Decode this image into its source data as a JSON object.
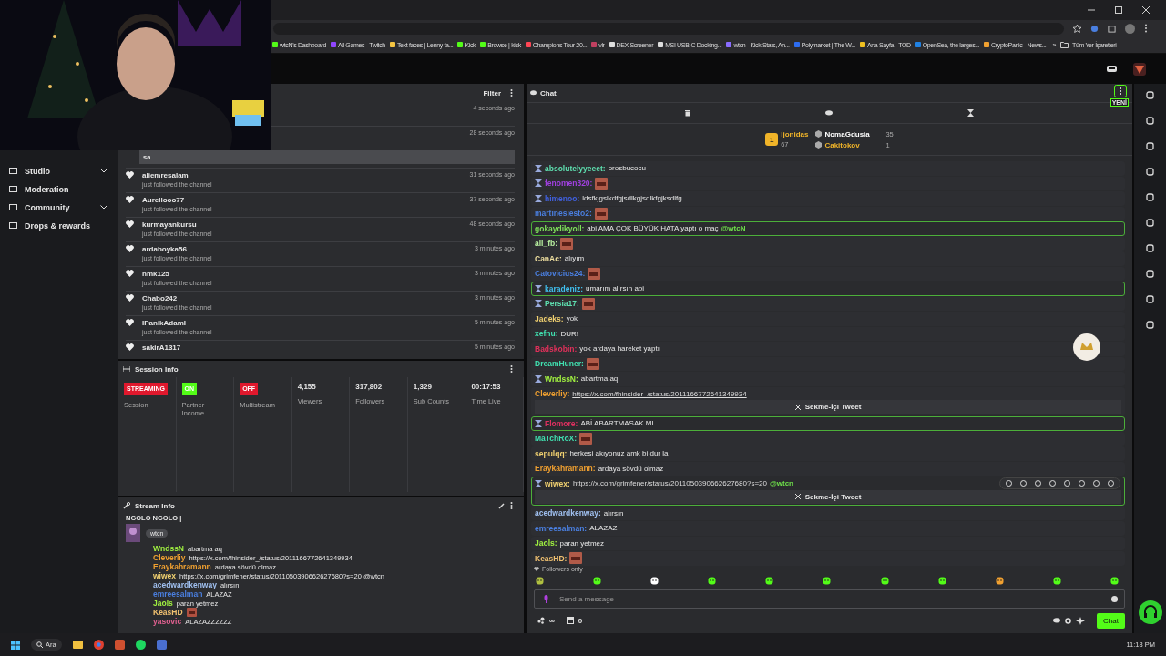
{
  "bookmarks": [
    {
      "label": "wtcN's Dashboard",
      "color": "#53fc18"
    },
    {
      "label": "All Games - Twitch",
      "color": "#9146ff"
    },
    {
      "label": "Text faces | Lenny fa...",
      "color": "#f5c542"
    },
    {
      "label": "Kick",
      "color": "#53fc18"
    },
    {
      "label": "Browse | kick",
      "color": "#53fc18"
    },
    {
      "label": "Champions Tour 20...",
      "color": "#ff4655"
    },
    {
      "label": "vlr",
      "color": "#c04060"
    },
    {
      "label": "DEX Screener",
      "color": "#dddddd"
    },
    {
      "label": "MSI USB-C Docking...",
      "color": "#dddddd"
    },
    {
      "label": "wtcn - Kick Stats, An...",
      "color": "#8a6cff"
    },
    {
      "label": "Polymarket | The W...",
      "color": "#2d6cf0"
    },
    {
      "label": "Ana Sayfa - TOD",
      "color": "#f0c020"
    },
    {
      "label": "OpenSea, the larges...",
      "color": "#2081e2"
    },
    {
      "label": "CryptoPanic - News...",
      "color": "#f0a030"
    }
  ],
  "bookmarks_more": "»",
  "all_bookmarks": "Tüm Yer İşaretleri",
  "sidebar": {
    "items": [
      {
        "label": "Studio",
        "expandable": true
      },
      {
        "label": "Moderation",
        "expandable": false
      },
      {
        "label": "Community",
        "expandable": true
      },
      {
        "label": "Drops & rewards",
        "expandable": false
      }
    ]
  },
  "activity": {
    "filter": "Filter",
    "events": [
      {
        "time": "4 seconds ago"
      },
      {
        "time": "28 seconds ago",
        "message": "sa"
      },
      {
        "user": "aliemresalam",
        "note": "just followed the channel",
        "time": "31 seconds ago"
      },
      {
        "user": "Aurellooo77",
        "note": "just followed the channel",
        "time": "37 seconds ago"
      },
      {
        "user": "kurmayankursu",
        "note": "just followed the channel",
        "time": "48 seconds ago"
      },
      {
        "user": "ardaboyka56",
        "note": "just followed the channel",
        "time": "3 minutes ago"
      },
      {
        "user": "hmk125",
        "note": "just followed the channel",
        "time": "3 minutes ago"
      },
      {
        "user": "Chabo242",
        "note": "just followed the channel",
        "time": "3 minutes ago"
      },
      {
        "user": "IPanikAdamI",
        "note": "just followed the channel",
        "time": "5 minutes ago"
      },
      {
        "user": "sakirA1317",
        "time": "5 minutes ago"
      }
    ]
  },
  "session_info": {
    "title": "Session Info",
    "tiles": [
      {
        "kind": "status",
        "badge": "STREAMING",
        "color": "#e0182d",
        "label": "Session"
      },
      {
        "kind": "status",
        "badge": "ON",
        "color": "#53fc18",
        "label": "Partner Income"
      },
      {
        "kind": "status",
        "badge": "OFF",
        "color": "#e0182d",
        "label": "Multistream"
      },
      {
        "kind": "stat",
        "value": "4,155",
        "label": "Viewers"
      },
      {
        "kind": "stat",
        "value": "317,802",
        "label": "Followers"
      },
      {
        "kind": "stat",
        "value": "1,329",
        "label": "Sub Counts"
      },
      {
        "kind": "stat",
        "value": "00:17:53",
        "label": "Time Live"
      }
    ]
  },
  "stream_info": {
    "title": "Stream Info",
    "stream_title": "NGOLO NGOLO |",
    "lines": [
      {
        "user": "WndssN",
        "color": "#a0f040",
        "text": "abartma aq"
      },
      {
        "user": "Cleverliy",
        "color": "#f0a030",
        "text": "https://x.com/fhinsider_/status/2011166772641349934"
      },
      {
        "user": "Eraykahramann",
        "color": "#f0a030",
        "text": "ardaya sövdü olmaz"
      },
      {
        "user": "wiwex",
        "color": "#f0d070",
        "text": "https://x.com/grimfener/status/2011050390662627680?s=20 @wtcn"
      },
      {
        "user": "acedwardkenway",
        "color": "#a0c0f0",
        "text": "alırsın"
      },
      {
        "user": "emreesalman",
        "color": "#4a7fe0",
        "text": "ALAZAZ"
      },
      {
        "user": "Jaols",
        "color": "#a0f040",
        "text": "paran yetmez"
      },
      {
        "user": "KeasHD",
        "color": "#f0c070",
        "emote": true
      },
      {
        "user": "yasovic",
        "color": "#e06090",
        "text": "ALAZAZZZZZZ"
      }
    ],
    "tags": [
      "wtcn"
    ]
  },
  "chat": {
    "title": "Chat",
    "new_badge": "YENİ",
    "gifters": [
      {
        "rank": "1",
        "name": "ljonidas",
        "count": "67",
        "color": "#f0b429"
      },
      {
        "name": "NomaGdusia",
        "count": "35",
        "color": "#ffffff"
      },
      {
        "name": "Cakitokov",
        "count": "1",
        "color": "#f0b429"
      }
    ],
    "messages": [
      {
        "user": "absolutelyyeeet:",
        "color": "#5ee0b0",
        "text": "orosbucocu",
        "badge": true,
        "highlighted": false
      },
      {
        "user": "fenomen320:",
        "color": "#a040e0",
        "emote": true,
        "badge": true,
        "highlighted": false
      },
      {
        "user": "himenoo:",
        "color": "#4060e0",
        "text": "ldsfkjgslkdfgjsdlkgjsdlkfgjksdlfg",
        "badge": true,
        "highlighted": false
      },
      {
        "user": "martinesiesto2:",
        "color": "#4a7fe0",
        "emote": true,
        "badge": false,
        "highlighted": false
      },
      {
        "user": "gokaydikyoll:",
        "color": "#7ee05a",
        "text": "abi AMA ÇOK BÜYÜK HATA yaptı o maç",
        "mention": "@wtcN",
        "badge": false,
        "highlighted": true
      },
      {
        "user": "ali_fb:",
        "color": "#b8f0a0",
        "emote": true,
        "badge": false,
        "highlighted": false
      },
      {
        "user": "CanAc:",
        "color": "#f0e0a0",
        "text": "alıyım",
        "badge": false,
        "highlighted": false
      },
      {
        "user": "Catovicius24:",
        "color": "#4a7fe0",
        "emote": true,
        "badge": false,
        "highlighted": false
      },
      {
        "user": "karadeniz:",
        "color": "#40c0f0",
        "text": "umarım alırsın abi",
        "badge": true,
        "highlighted": true
      },
      {
        "user": "Persia17:",
        "color": "#5ee0b0",
        "emote": true,
        "badge": true,
        "highlighted": false
      },
      {
        "user": "Jadeks:",
        "color": "#f0d070",
        "text": "yok",
        "badge": false,
        "highlighted": false
      },
      {
        "user": "xefnu:",
        "color": "#40e0b0",
        "text": "DUR!",
        "badge": false,
        "highlighted": false
      },
      {
        "user": "Badskobin:",
        "color": "#e0305a",
        "text": "yok ardaya hareket yaptı",
        "badge": false,
        "highlighted": false
      },
      {
        "user": "DreamHuner:",
        "color": "#40e0b0",
        "emote": true,
        "badge": false,
        "highlighted": false
      },
      {
        "user": "WndssN:",
        "color": "#a0f040",
        "text": "abartma aq",
        "badge": true,
        "highlighted": false
      },
      {
        "user": "Cleverliy:",
        "color": "#f0a030",
        "link": "https://x.com/fhinsider_/status/2011166772641349934",
        "tweet": "Sekme-İçi Tweet",
        "badge": false,
        "highlighted": false
      },
      {
        "user": "Flomore:",
        "color": "#e03060",
        "text": "ABİ ABARTMASAK MI",
        "badge": true,
        "highlighted": true
      },
      {
        "user": "MaTchRoX:",
        "color": "#40e0b0",
        "emote": true,
        "badge": false,
        "highlighted": false
      },
      {
        "user": "sepulqq:",
        "color": "#f0d070",
        "text": "herkesi akıyonuz amk bi dur la",
        "badge": false,
        "highlighted": false
      },
      {
        "user": "Eraykahramann:",
        "color": "#f0a030",
        "text": "ardaya sövdü olmaz",
        "badge": false,
        "highlighted": false
      },
      {
        "user": "wiwex:",
        "color": "#f0d070",
        "link": "https://x.com/grimfener/status/2011050390662627680?s=20",
        "mention": "@wtcn",
        "tweet": "Sekme-İçi Tweet",
        "badge": true,
        "highlighted": true,
        "toolbar": true
      },
      {
        "user": "acedwardkenway:",
        "color": "#a0c0f0",
        "text": "alırsın",
        "badge": false,
        "highlighted": false
      },
      {
        "user": "emreesalman:",
        "color": "#4a7fe0",
        "text": "ALAZAZ",
        "badge": false,
        "highlighted": false
      },
      {
        "user": "Jaols:",
        "color": "#a0f040",
        "text": "paran yetmez",
        "badge": false,
        "highlighted": false
      },
      {
        "user": "KeasHD:",
        "color": "#f0c070",
        "emote": true,
        "badge": false,
        "highlighted": false
      }
    ],
    "mode": "Followers only",
    "placeholder": "Send a message",
    "points": "∞",
    "store_count": "0",
    "send": "Chat"
  },
  "taskbar": {
    "search": "Ara",
    "time": "11:18 PM"
  }
}
